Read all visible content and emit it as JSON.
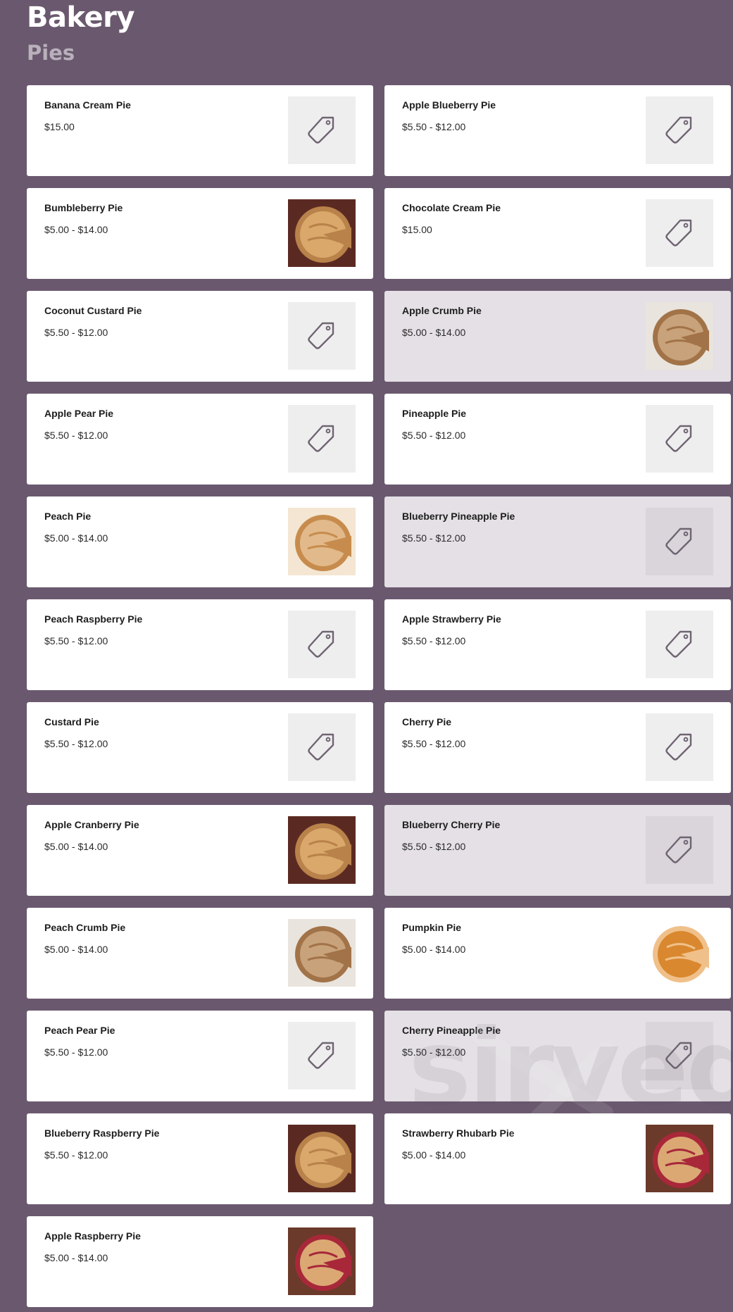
{
  "header": {
    "title": "Bakery",
    "section": "Pies"
  },
  "watermark": "sirved",
  "items": [
    {
      "name": "Banana Cream Pie",
      "price": "$15.00",
      "image": "tag-icon",
      "dim": false
    },
    {
      "name": "Apple Blueberry Pie",
      "price": "$5.50 - $12.00",
      "image": "tag-icon",
      "dim": false
    },
    {
      "name": "Bumbleberry Pie",
      "price": "$5.00 - $14.00",
      "image": "pie-photo",
      "dim": false
    },
    {
      "name": "Chocolate Cream Pie",
      "price": "$15.00",
      "image": "tag-icon",
      "dim": false
    },
    {
      "name": "Coconut Custard Pie",
      "price": "$5.50 - $12.00",
      "image": "tag-icon",
      "dim": false
    },
    {
      "name": "Apple Crumb Pie",
      "price": "$5.00 - $14.00",
      "image": "crumb-pie-photo",
      "dim": true
    },
    {
      "name": "Apple Pear Pie",
      "price": "$5.50 - $12.00",
      "image": "tag-icon",
      "dim": false
    },
    {
      "name": "Pineapple Pie",
      "price": "$5.50 - $12.00",
      "image": "tag-icon",
      "dim": false
    },
    {
      "name": "Peach Pie",
      "price": "$5.00 - $14.00",
      "image": "pie-slice-photo",
      "dim": false
    },
    {
      "name": "Blueberry Pineapple Pie",
      "price": "$5.50 - $12.00",
      "image": "tag-icon",
      "dim": true
    },
    {
      "name": "Peach Raspberry Pie",
      "price": "$5.50 - $12.00",
      "image": "tag-icon",
      "dim": false
    },
    {
      "name": "Apple Strawberry Pie",
      "price": "$5.50 - $12.00",
      "image": "tag-icon",
      "dim": false
    },
    {
      "name": "Custard Pie",
      "price": "$5.50 - $12.00",
      "image": "tag-icon",
      "dim": false
    },
    {
      "name": "Cherry Pie",
      "price": "$5.50 - $12.00",
      "image": "tag-icon",
      "dim": false
    },
    {
      "name": "Apple Cranberry Pie",
      "price": "$5.00 - $14.00",
      "image": "pie-photo",
      "dim": false
    },
    {
      "name": "Blueberry Cherry Pie",
      "price": "$5.50 - $12.00",
      "image": "tag-icon",
      "dim": true
    },
    {
      "name": "Peach Crumb Pie",
      "price": "$5.00 - $14.00",
      "image": "crumb-pie-photo",
      "dim": false
    },
    {
      "name": "Pumpkin Pie",
      "price": "$5.00 - $14.00",
      "image": "pumpkin-pie-photo",
      "dim": false
    },
    {
      "name": "Peach Pear Pie",
      "price": "$5.50 - $12.00",
      "image": "tag-icon",
      "dim": false
    },
    {
      "name": "Cherry Pineapple Pie",
      "price": "$5.50 - $12.00",
      "image": "tag-icon",
      "dim": true
    },
    {
      "name": "Blueberry Raspberry Pie",
      "price": "$5.50 - $12.00",
      "image": "pie-photo",
      "dim": false
    },
    {
      "name": "Strawberry Rhubarb Pie",
      "price": "$5.00 - $14.00",
      "image": "berry-pie-photo",
      "dim": false
    },
    {
      "name": "Apple Raspberry Pie",
      "price": "$5.00 - $14.00",
      "image": "berry-pie-photo",
      "dim": false
    }
  ],
  "colors": {
    "background": "#6a596e",
    "card": "#ffffff",
    "card_dim": "#e4e0e5",
    "thumb_bg": "#efeeef",
    "icon_stroke": "#6f6472"
  }
}
